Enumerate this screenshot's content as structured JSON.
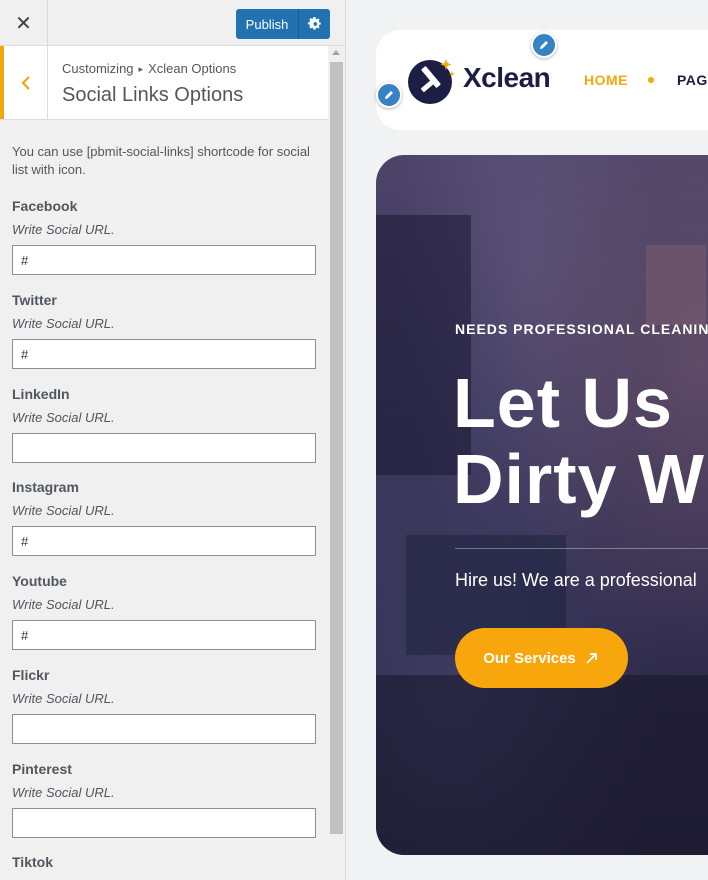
{
  "topbar": {
    "close_glyph": "✕",
    "publish_label": "Publish"
  },
  "section": {
    "breadcrumb_parent": "Customizing",
    "breadcrumb_sep": "▸",
    "breadcrumb_child": "Xclean Options",
    "title": "Social Links Options"
  },
  "description": "You can use [pbmit-social-links] shortcode for social list with icon.",
  "fields": [
    {
      "label": "Facebook",
      "desc": "Write Social URL.",
      "value": "#"
    },
    {
      "label": "Twitter",
      "desc": "Write Social URL.",
      "value": "#"
    },
    {
      "label": "LinkedIn",
      "desc": "Write Social URL.",
      "value": ""
    },
    {
      "label": "Instagram",
      "desc": "Write Social URL.",
      "value": "#"
    },
    {
      "label": "Youtube",
      "desc": "Write Social URL.",
      "value": "#"
    },
    {
      "label": "Flickr",
      "desc": "Write Social URL.",
      "value": ""
    },
    {
      "label": "Pinterest",
      "desc": "Write Social URL.",
      "value": ""
    },
    {
      "label": "Tiktok",
      "desc": "",
      "value": ""
    }
  ],
  "preview": {
    "logo_text": "Xclean",
    "nav": {
      "home": "HOME",
      "pages": "PAGE"
    },
    "hero": {
      "tagline": "NEEDS PROFESSIONAL CLEANING",
      "title_line1": "Let Us",
      "title_line2": "Dirty W",
      "subtitle": "Hire us! We are a professional",
      "button": "Our Services"
    }
  },
  "colors": {
    "publish_blue": "#2271b1",
    "accent_orange": "#f7a70b",
    "brand_navy": "#1d1e45"
  },
  "icons": [
    "close-icon",
    "gear-icon",
    "chevron-left-icon",
    "pencil-icon",
    "logo-icon",
    "arrow-up-right-icon"
  ]
}
